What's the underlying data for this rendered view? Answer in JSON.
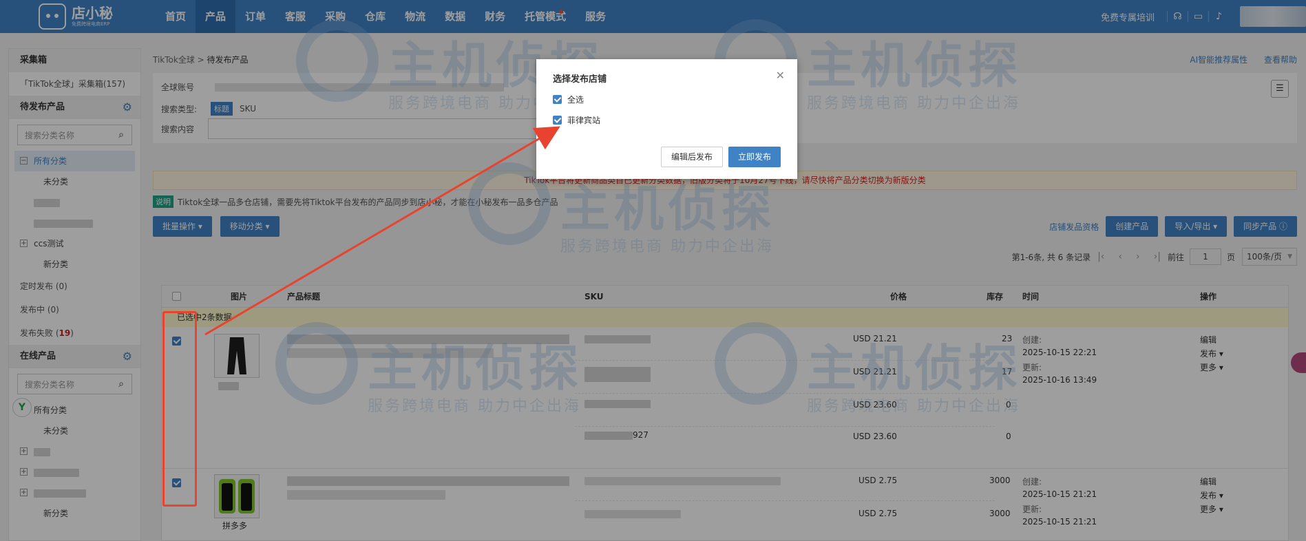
{
  "header": {
    "logo_name": "店小秘",
    "logo_sub": "免费跨境电商ERP",
    "nav": [
      "首页",
      "产品",
      "订单",
      "客服",
      "采购",
      "仓库",
      "物流",
      "数据",
      "财务",
      "托管模式",
      "服务"
    ],
    "active_nav": "产品",
    "training_link": "免费专属培训"
  },
  "sidebar": {
    "collect_title": "采集箱",
    "collect_item": "「TikTok全球」采集箱(157)",
    "pending_title": "待发布产品",
    "search_placeholder": "搜索分类名称",
    "all_category": "所有分类",
    "uncategorized": "未分类",
    "ccs_test": "ccs测试",
    "new_category": "新分类",
    "scheduled": "定时发布 (0)",
    "publishing": "发布中 (0)",
    "failed_label": "发布失败 (",
    "failed_count": "19",
    "failed_end": ")",
    "online_title": "在线产品"
  },
  "main": {
    "breadcrumb_root": "TikTok全球",
    "breadcrumb_sep": " > ",
    "breadcrumb_current": "待发布产品",
    "ai_link": "AI智能推荐属性",
    "help_link": "查看帮助",
    "global_account_label": "全球账号",
    "search_type_label": "搜索类型:",
    "search_type_tag": "标题",
    "search_type_sku": "SKU",
    "search_content_label": "搜索内容",
    "warning": "TikTok平台将更新商品类目已更新分类数据，旧版分类将于10月27号下线，请尽快将产品分类切换为新版分类",
    "note_tag": "说明",
    "note_text": "Tiktok全球一品多仓店铺，需要先将Tiktok平台发布的产品同步到店小秘，才能在小秘发布一品多仓产品",
    "batch_btn": "批量操作 ▾",
    "move_btn": "移动分类 ▾",
    "store_qualify": "店铺发品资格",
    "create_btn": "创建产品",
    "import_btn": "导入/导出 ▾",
    "sync_btn": "同步产品 ⓘ",
    "pager_info": "第1-6条, 共 6 条记录",
    "pager_goto": "前往",
    "pager_page": "1",
    "pager_unit": "页",
    "pager_size": "100条/页"
  },
  "table": {
    "headers": {
      "image": "图片",
      "title": "产品标题",
      "sku": "SKU",
      "price": "价格",
      "stock": "库存",
      "time": "时间",
      "ops": "操作"
    },
    "selected_note": "已选中2条数据",
    "rows": [
      {
        "prices": [
          "USD 21.21",
          "USD 21.21",
          "USD 23.60",
          "USD 23.60"
        ],
        "stocks": [
          "23",
          "17",
          "0",
          "0"
        ],
        "sku_tail": "927",
        "created_label": "创建:",
        "created": "2025-10-15 22:21",
        "updated_label": "更新:",
        "updated": "2025-10-16 13:49",
        "ops": [
          "编辑",
          "发布 ▾",
          "更多 ▾"
        ]
      },
      {
        "prices": [
          "USD 2.75",
          "USD 2.75"
        ],
        "stocks": [
          "3000",
          "3000"
        ],
        "source": "拼多多",
        "created_label": "创建:",
        "created": "2025-10-15 21:21",
        "updated_label": "更新:",
        "updated": "2025-10-15 21:21",
        "ops": [
          "编辑",
          "发布 ▾",
          "更多 ▾"
        ]
      }
    ]
  },
  "modal": {
    "title": "选择发布店铺",
    "select_all": "全选",
    "store": "菲律宾站",
    "edit_publish": "编辑后发布",
    "publish_now": "立即发布"
  },
  "watermark": {
    "title": "主机侦探",
    "subtitle": "服务跨境电商 助力中企出海"
  },
  "colors": {
    "brand": "#3f82c6",
    "warning_text": "#d62020",
    "annotation": "#e8432f"
  }
}
